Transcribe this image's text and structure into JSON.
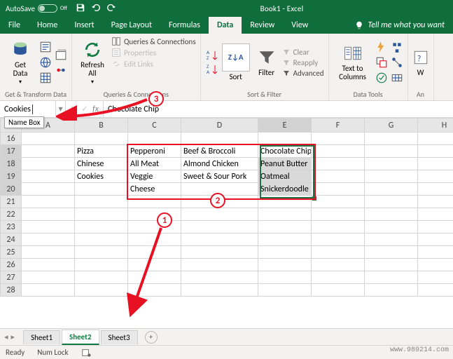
{
  "titlebar": {
    "autosave_label": "AutoSave",
    "autosave_state": "Off",
    "title": "Book1 - Excel"
  },
  "tabs": {
    "file": "File",
    "home": "Home",
    "insert": "Insert",
    "page_layout": "Page Layout",
    "formulas": "Formulas",
    "data": "Data",
    "review": "Review",
    "view": "View",
    "tellme": "Tell me what you want"
  },
  "ribbon": {
    "get_data": "Get\nData",
    "group_gettransform": "Get & Transform Data",
    "refresh_all": "Refresh\nAll",
    "queries": "Queries & Connections",
    "properties": "Properties",
    "edit_links": "Edit Links",
    "group_queries": "Queries & Connections",
    "sort": "Sort",
    "filter": "Filter",
    "clear": "Clear",
    "reapply": "Reapply",
    "advanced": "Advanced",
    "group_sortfilter": "Sort & Filter",
    "text_to_columns": "Text to\nColumns",
    "group_datatools": "Data Tools",
    "group_whatif": "W",
    "analysis_cut": "An"
  },
  "formula_bar": {
    "name_box": "Cookies",
    "name_box_tooltip": "Name Box",
    "value": "Chocolate Chip"
  },
  "columns": [
    "A",
    "B",
    "C",
    "D",
    "E",
    "F",
    "G",
    "H"
  ],
  "rows": [
    "16",
    "17",
    "18",
    "19",
    "20",
    "21",
    "22",
    "23",
    "24",
    "25",
    "26",
    "27",
    "28"
  ],
  "cells": {
    "B17": "Pizza",
    "B18": "Chinese",
    "B19": "Cookies",
    "C17": "Pepperoni",
    "C18": "All Meat",
    "C19": "Veggie",
    "C20": "Cheese",
    "D17": "Beef & Broccoli",
    "D18": "Almond Chicken",
    "D19": "Sweet & Sour Pork",
    "E17": "Chocolate Chip",
    "E18": "Peanut Butter",
    "E19": "Oatmeal",
    "E20": "Snickerdoodle"
  },
  "sheets": {
    "s1": "Sheet1",
    "s2": "Sheet2",
    "s3": "Sheet3"
  },
  "status": {
    "ready": "Ready",
    "numlock": "Num Lock"
  },
  "callouts": {
    "step1": "1",
    "step2": "2",
    "step3": "3"
  },
  "watermark": "www.989214.com"
}
